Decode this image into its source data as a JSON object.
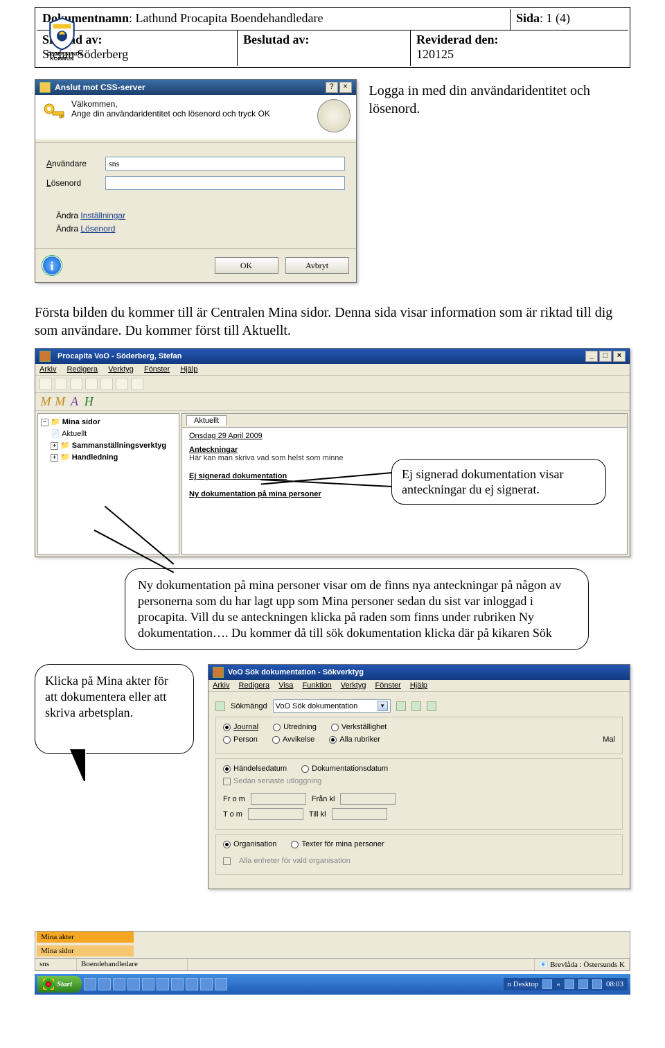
{
  "header": {
    "docname_label": "Dokumentnamn",
    "docname": "Lathund Procapita Boendehandledare",
    "sida_label": "Sida",
    "sida": "1 (4)",
    "skapad_label": "Skapad av:",
    "skapad": "Stefan Söderberg",
    "beslutad_label": "Beslutad av:",
    "reviderad_label": "Reviderad den:",
    "reviderad": "120125",
    "logo_name": "ÖSTERSUNDS KOMMUN"
  },
  "login": {
    "title": "Anslut mot CSS-server",
    "help_btn": "?",
    "close_btn": "×",
    "welcome": "Välkommen,",
    "instr": "Ange din användaridentitet och lösenord och tryck OK",
    "user_label_pre": "A",
    "user_label": "nvändare",
    "user_value": "sns",
    "pass_label_pre": "L",
    "pass_label": "ösenord",
    "link1_pre": "Ä",
    "link1_a": "ndra ",
    "link1_b": "Inställningar",
    "link2_pre": "Ändra ",
    "link2_a": "L",
    "link2_b": "ösenord",
    "ok": "OK",
    "cancel": "Avbryt",
    "side_note": "Logga in med din användaridentitet och lösenord."
  },
  "para1": "Första bilden du kommer till är Centralen Mina sidor. Denna sida visar information som är riktad till dig som användare. Du kommer först till Aktuellt.",
  "app": {
    "title": "Procapita VoO - Söderberg, Stefan",
    "menu": [
      "Arkiv",
      "Redigera",
      "Verktyg",
      "Fönster",
      "Hjälp"
    ],
    "tree": {
      "root": "Mina sidor",
      "items": [
        "Aktuellt",
        "Sammanställningsverktyg",
        "Handledning"
      ]
    },
    "tab": "Aktuellt",
    "date": "Onsdag 29 April 2009",
    "s1": "Anteckningar",
    "s1sub": "Här kan man skriva vad som helst som minne",
    "s2": "Ej signerad dokumentation",
    "s3": "Ny dokumentation på mina personer"
  },
  "callout1": "Ej signerad dokumentation visar anteckningar du ej signerat.",
  "callout2": "Ny dokumentation på mina personer visar om de finns nya anteckningar på någon av personerna som du har lagt upp som Mina personer sedan du sist var inloggad i procapita.\nVill du se anteckningen klicka på raden som finns under rubriken Ny dokumentation…. Du kommer då till sök dokumentation klicka där på kikaren Sök",
  "callout3": "Klicka på Mina akter för att dokumentera eller att skriva arbetsplan.",
  "sok": {
    "title": "VoO Sök dokumentation - Sökverktyg",
    "menu": [
      "Arkiv",
      "Redigera",
      "Visa",
      "Funktion",
      "Verktyg",
      "Fönster",
      "Hjälp"
    ],
    "sokmangd_label": "Sökmängd",
    "sokmangd_value": "VoO Sök dokumentation",
    "radios1": [
      "Journal",
      "Utredning",
      "Verkställighet",
      "Person",
      "Avvikelse",
      "Alla rubriker"
    ],
    "radios1_selected": [
      0,
      5
    ],
    "mal": "Mal",
    "radios2": [
      "Händelsedatum",
      "Dokumentationsdatum"
    ],
    "radios2_selected": 0,
    "chk_label": "Sedan senaste utloggning",
    "from": "Fr o m",
    "franhkl": "Från kl",
    "tom": "T o m",
    "tillkl": "Till kl",
    "radios3": [
      "Organisation",
      "Texter för mina personer"
    ],
    "radios3_selected": 0,
    "footer": "Alla enheter för vald organisation"
  },
  "bottom": {
    "mina_akter": "Mina akter",
    "mina_sidor": "Mina sidor",
    "status_user": "sns",
    "status_role": "Boendehandledare",
    "brev": "Brevlåda : Östersunds K"
  },
  "taskbar": {
    "start": "Start",
    "tasks": [
      "",
      "",
      "",
      ""
    ],
    "tray_text": "n Desktop",
    "clock": "08:03"
  }
}
